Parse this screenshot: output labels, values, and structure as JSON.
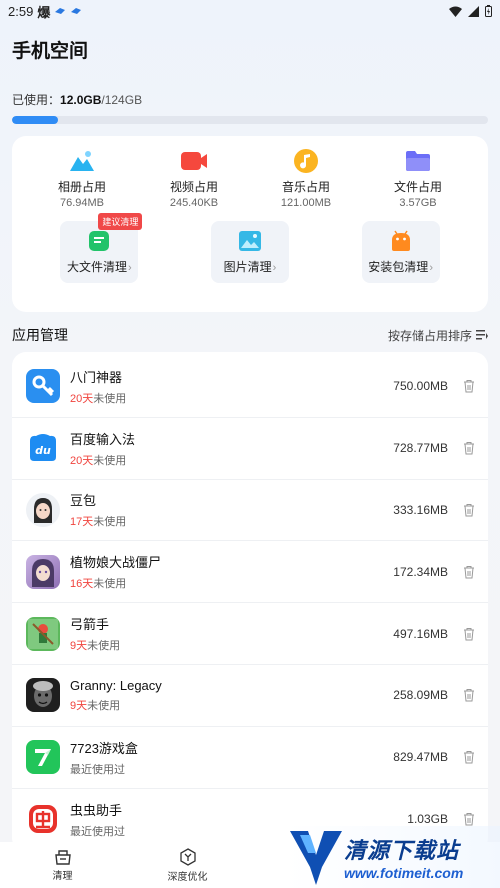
{
  "status_bar": {
    "time": "2:59",
    "extra": "爆"
  },
  "header": {
    "title": "手机空间",
    "used_label": "已使用：",
    "used_value": "12.0GB",
    "total_value": "/124GB",
    "progress_fraction": 0.097
  },
  "categories": [
    {
      "name": "相册占用",
      "size": "76.94MB",
      "icon": "photo-icon",
      "color": "#28b3f0"
    },
    {
      "name": "视频占用",
      "size": "245.40KB",
      "icon": "video-icon",
      "color": "#f5483d"
    },
    {
      "name": "音乐占用",
      "size": "121.00MB",
      "icon": "music-icon",
      "color": "#fbb421"
    },
    {
      "name": "文件占用",
      "size": "3.57GB",
      "icon": "folder-icon",
      "color": "#6b6ef7"
    }
  ],
  "cleaners": [
    {
      "label": "大文件清理",
      "badge": "建议清理",
      "icon": "large-file-icon"
    },
    {
      "label": "图片清理",
      "icon": "image-clean-icon"
    },
    {
      "label": "安装包清理",
      "icon": "android-package-icon"
    }
  ],
  "app_section": {
    "title": "应用管理",
    "sort_label": "按存储占用排序"
  },
  "apps": [
    {
      "name": "八门神器",
      "days": "20天",
      "usage_suffix": "未使用",
      "size": "750.00MB",
      "icon": "bamen-icon",
      "bg": "#2a8ff0"
    },
    {
      "name": "百度输入法",
      "days": "20天",
      "usage_suffix": "未使用",
      "size": "728.77MB",
      "icon": "baidu-input-icon",
      "bg": "#1e8cf2"
    },
    {
      "name": "豆包",
      "days": "17天",
      "usage_suffix": "未使用",
      "size": "333.16MB",
      "icon": "doubao-icon",
      "bg": "#e8ecf2"
    },
    {
      "name": "植物娘大战僵尸",
      "days": "16天",
      "usage_suffix": "未使用",
      "size": "172.34MB",
      "icon": "plant-girl-icon",
      "bg": "#b59ad0"
    },
    {
      "name": "弓箭手",
      "days": "9天",
      "usage_suffix": "未使用",
      "size": "497.16MB",
      "icon": "archer-icon",
      "bg": "#3ea84a"
    },
    {
      "name": "Granny: Legacy",
      "days": "9天",
      "usage_suffix": "未使用",
      "size": "258.09MB",
      "icon": "granny-icon",
      "bg": "#2a2a2a"
    },
    {
      "name": "7723游戏盒",
      "days": "",
      "usage_suffix": "最近使用过",
      "size": "829.47MB",
      "icon": "7723-icon",
      "bg": "#22c55a"
    },
    {
      "name": "虫虫助手",
      "days": "",
      "usage_suffix": "最近使用过",
      "size": "1.03GB",
      "icon": "chongchong-icon",
      "bg": "#ffffff"
    }
  ],
  "bottom_nav": [
    {
      "label": "清理",
      "icon": "clean-icon"
    },
    {
      "label": "深度优化",
      "icon": "deep-optimize-icon"
    }
  ],
  "watermark": {
    "title": "清源下载站",
    "url": "www.fotimeit.com"
  }
}
